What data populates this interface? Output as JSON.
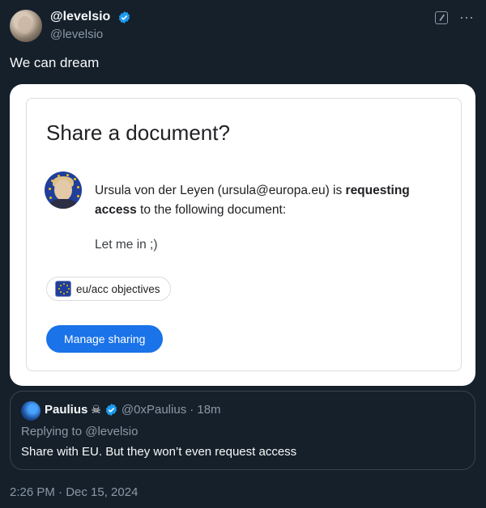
{
  "author": {
    "display_name": "@levelsio",
    "handle": "@levelsio",
    "verified_icon": "verified-badge-icon"
  },
  "tweet": {
    "text": "We can dream",
    "timestamp": "2:26 PM · Dec 15, 2024"
  },
  "media": {
    "title": "Share a document?",
    "requester_text": "Ursula von der Leyen (ursula@europa.eu) is ",
    "requester_bold": "requesting access",
    "requester_tail": " to the following document:",
    "message": "Let me in ;)",
    "document_chip": "eu/acc objectives",
    "manage_button": "Manage sharing"
  },
  "quote": {
    "display_name": "Paulius",
    "emoji": "☠",
    "handle": "@0xPaulius",
    "age": "· 18m",
    "replying_to": "Replying to @levelsio",
    "text": "Share with EU. But they won’t even request access"
  },
  "colors": {
    "background": "#15202b",
    "muted": "#8b98a5",
    "verified": "#1d9bf0",
    "button": "#1a73e8"
  }
}
